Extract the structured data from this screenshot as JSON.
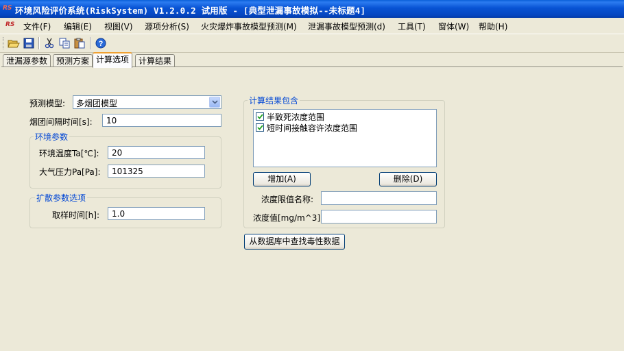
{
  "window": {
    "app_icon_text": "RS",
    "title": "环境风险评价系统(RiskSystem) V1.2.0.2 试用版 - [典型泄漏事故模拟--未标题4]"
  },
  "menu": {
    "logo_text": "RS",
    "items": [
      {
        "label": "文件(F)"
      },
      {
        "label": "编辑(E)"
      },
      {
        "label": "视图(V)"
      },
      {
        "label": "源项分析(S)"
      },
      {
        "label": "火灾爆炸事故模型预测(M)"
      },
      {
        "label": "泄漏事故模型预测(d)"
      },
      {
        "label": "工具(T)"
      },
      {
        "label": "窗体(W)"
      },
      {
        "label": "帮助(H)"
      }
    ]
  },
  "toolbar": {
    "buttons": [
      "open-icon",
      "save-icon",
      "cut-icon",
      "copy-icon",
      "paste-icon",
      "help-icon"
    ]
  },
  "tabs": [
    {
      "label": "泄漏源参数"
    },
    {
      "label": "预测方案"
    },
    {
      "label": "计算选项",
      "active": true
    },
    {
      "label": "计算结果"
    }
  ],
  "form": {
    "model_label": "预测模型:",
    "model_value": "多烟团模型",
    "puff_interval_label": "烟团间隔时间[s]:",
    "puff_interval_value": "10",
    "env_group": {
      "title": "环境参数",
      "temp_label": "环境温度Ta[℃]:",
      "temp_value": "20",
      "pressure_label": "大气压力Pa[Pa]:",
      "pressure_value": "101325"
    },
    "diffusion_group": {
      "title": "扩散参数选项",
      "sampling_label": "取样时间[h]:",
      "sampling_value": "1.0"
    },
    "results_group": {
      "title": "计算结果包含",
      "items": [
        {
          "label": "半致死浓度范围",
          "checked": true
        },
        {
          "label": "短时间接触容许浓度范围",
          "checked": true
        }
      ],
      "add_button": "增加(A)",
      "delete_button": "删除(D)",
      "limit_name_label": "浓度限值名称:",
      "limit_name_value": "",
      "conc_label": "浓度值[mg/m^3]:",
      "conc_value": ""
    },
    "lookup_button": "从数据库中查找毒性数据"
  },
  "colors": {
    "titlebar": "#0853d4",
    "group_title": "#0046d5",
    "active_tab_accent": "#f0a030"
  }
}
